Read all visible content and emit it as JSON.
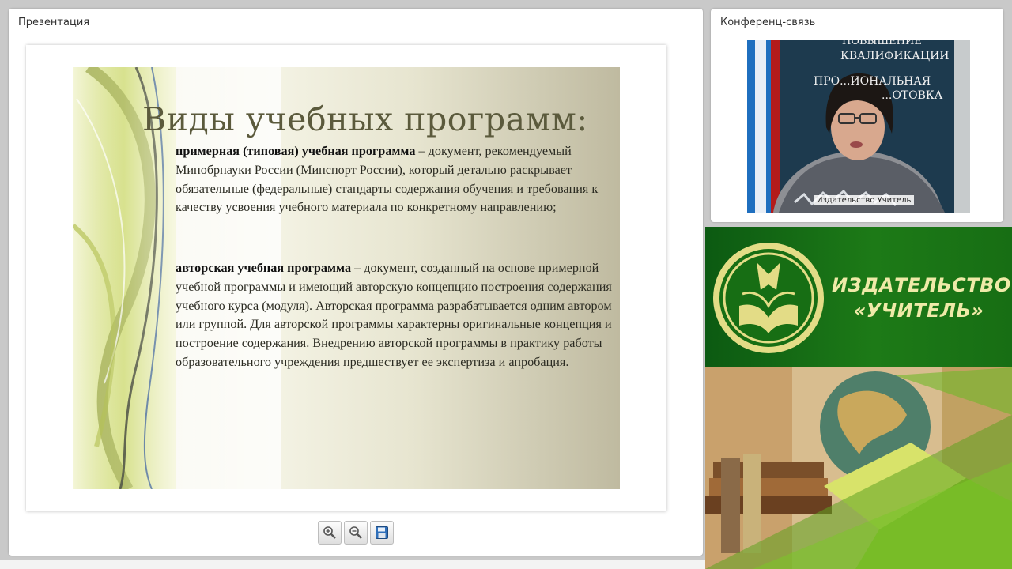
{
  "presentation": {
    "title": "Презентация",
    "slide": {
      "heading": "Виды учебных программ:",
      "item1_bold": "примерная (типовая) учебная программа",
      "item1_text": " – документ, рекомендуемый Минобрнауки России (Минспорт России), который детально раскрывает обязательные (федеральные) стандарты содержания обучения и требования к качеству усвоения учебного материала по конкретному направлению;",
      "item2_bold": "авторская учебная программа",
      "item2_text": " – документ, созданный на основе примерной учебной программы и имеющий авторскую концепцию построения содержания учебного курса (модуля). Авторская программа разрабатывается одним автором или группой. Для авторской программы характерны оригинальные концепция и построение содержания. Внедрению авторской программы в практику работы образовательного учреждения предшествует ее экспертиза и апробация."
    },
    "tools": [
      {
        "name": "zoom-in",
        "icon": "zoom-in-icon"
      },
      {
        "name": "zoom-out",
        "icon": "zoom-out-icon"
      },
      {
        "name": "save",
        "icon": "save-icon"
      }
    ]
  },
  "conference": {
    "title": "Конференц-связь",
    "participant_name": "Издательство Учитель",
    "background_sign": {
      "line1": "ПОВЫШЕНИЕ",
      "line2": "КВАЛИФИКАЦИИ",
      "line3": "ПРО...ИОНАЛЬНАЯ",
      "line4": "...ОТОВКА"
    }
  },
  "banner": {
    "line1": "ИЗДАТЕЛЬСТВО",
    "line2": "«УЧИТЕЛЬ»",
    "colors": {
      "green": "#176e14",
      "text": "#efeaa8"
    }
  }
}
